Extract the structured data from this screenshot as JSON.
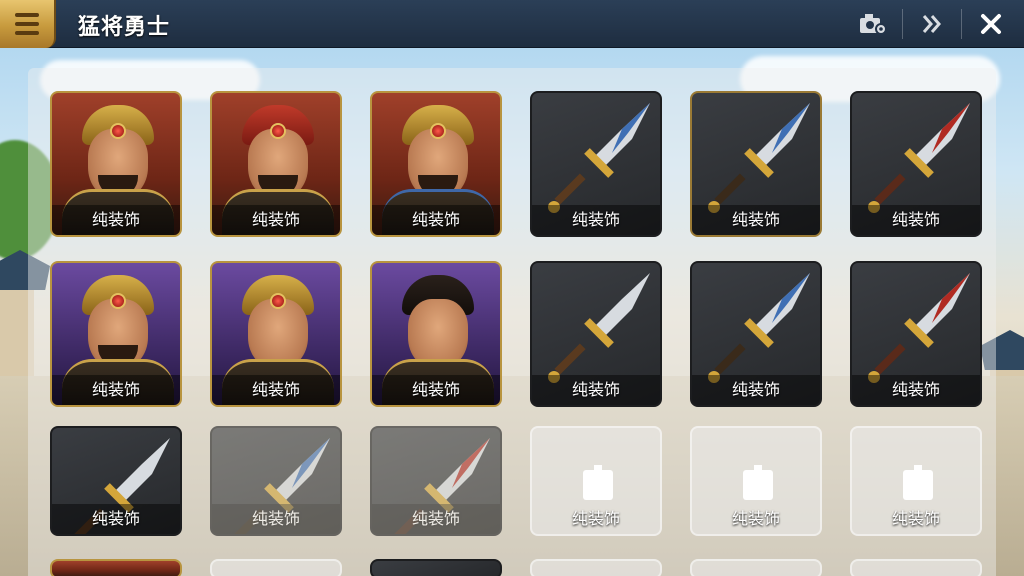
{
  "header": {
    "title": "猛将勇士"
  },
  "icons": {
    "menu": "menu-icon",
    "settings": "settings-camera-icon",
    "forward": "double-chevron-right-icon",
    "close": "close-icon"
  },
  "tile_label": "纯装饰",
  "rows": [
    [
      {
        "kind": "hero",
        "variant": "red",
        "label": "纯装饰"
      },
      {
        "kind": "hero",
        "variant": "red",
        "label": "纯装饰"
      },
      {
        "kind": "hero",
        "variant": "red",
        "label": "纯装饰"
      },
      {
        "kind": "weapon",
        "variant": "blue-gold",
        "label": "纯装饰"
      },
      {
        "kind": "weapon",
        "variant": "blue-gold",
        "label": "纯装饰"
      },
      {
        "kind": "weapon",
        "variant": "red-gold",
        "label": "纯装饰"
      }
    ],
    [
      {
        "kind": "hero",
        "variant": "purple",
        "label": "纯装饰"
      },
      {
        "kind": "hero",
        "variant": "purple",
        "label": "纯装饰"
      },
      {
        "kind": "hero",
        "variant": "purple",
        "label": "纯装饰"
      },
      {
        "kind": "weapon",
        "variant": "gold",
        "label": "纯装饰"
      },
      {
        "kind": "weapon",
        "variant": "blue-gold",
        "label": "纯装饰"
      },
      {
        "kind": "weapon",
        "variant": "red-gold",
        "label": "纯装饰"
      }
    ],
    [
      {
        "kind": "weapon",
        "variant": "gold",
        "label": "纯装饰"
      },
      {
        "kind": "weapon",
        "variant": "blue-gold",
        "label": "纯装饰"
      },
      {
        "kind": "weapon",
        "variant": "red-gold",
        "label": "纯装饰"
      },
      {
        "kind": "ghost",
        "variant": "locked",
        "label": "纯装饰"
      },
      {
        "kind": "ghost",
        "variant": "locked",
        "label": "纯装饰"
      },
      {
        "kind": "ghost",
        "variant": "locked",
        "label": "纯装饰"
      }
    ]
  ],
  "colors": {
    "topbar": "#223349",
    "menu_gold": "#c79a3d",
    "hero_border": "#b8943f",
    "label_text": "#ffffff"
  }
}
